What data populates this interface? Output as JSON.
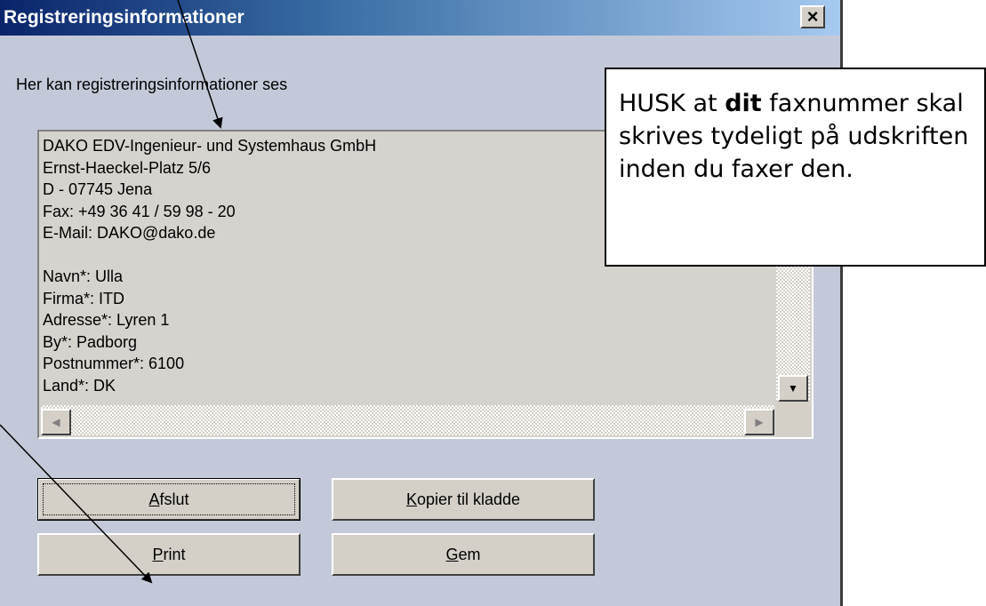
{
  "window": {
    "title": "Registreringsinformationer",
    "close_label": "×"
  },
  "hint": "Her kan registreringsinformationer ses",
  "info_lines": [
    "DAKO EDV-Ingenieur- und Systemhaus GmbH",
    "Ernst-Haeckel-Platz 5/6",
    "D - 07745 Jena",
    "Fax: +49 36 41 / 59 98 - 20",
    "E-Mail: DAKO@dako.de",
    "",
    "Navn*: Ulla",
    "Firma*: ITD",
    "Adresse*: Lyren 1",
    "By*: Padborg",
    "Postnummer*: 6100",
    "Land*: DK"
  ],
  "scrollbar": {
    "down_icon": "arrow-down",
    "left_icon": "arrow-left",
    "right_icon": "arrow-right"
  },
  "buttons": {
    "afslut": {
      "accel": "A",
      "rest": "fslut"
    },
    "kopier": {
      "accel": "K",
      "rest": "opier til kladde"
    },
    "print": {
      "accel": "P",
      "rest": "rint"
    },
    "gem": {
      "accel": "G",
      "rest": "em"
    }
  },
  "callout": {
    "before": "HUSK at ",
    "bold": "dit",
    "after": " faxnummer skal skrives tydeligt på udskriften inden du faxer den."
  }
}
